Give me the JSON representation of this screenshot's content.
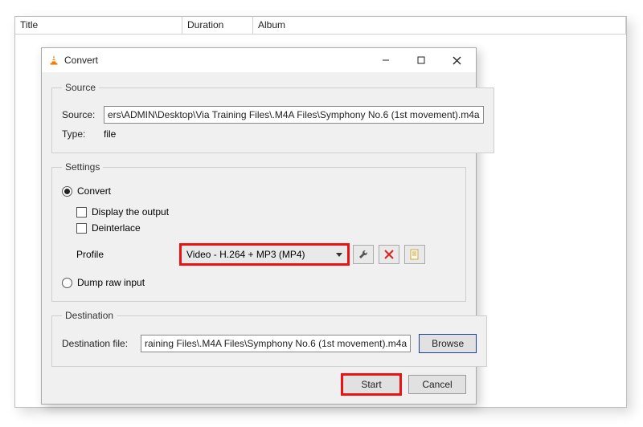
{
  "header": {
    "title": "Title",
    "duration": "Duration",
    "album": "Album"
  },
  "dialog": {
    "title": "Convert",
    "source": {
      "legend": "Source",
      "source_label": "Source:",
      "source_value": "ers\\ADMIN\\Desktop\\Via Training Files\\.M4A Files\\Symphony No.6 (1st movement).m4a",
      "type_label": "Type:",
      "type_value": "file"
    },
    "settings": {
      "legend": "Settings",
      "convert_label": "Convert",
      "display_output_label": "Display the output",
      "deinterlace_label": "Deinterlace",
      "profile_label": "Profile",
      "profile_value": "Video - H.264 + MP3 (MP4)",
      "dump_label": "Dump raw input"
    },
    "destination": {
      "legend": "Destination",
      "label": "Destination file:",
      "value": "raining Files\\.M4A Files\\Symphony No.6 (1st movement).m4a",
      "browse": "Browse"
    },
    "buttons": {
      "start": "Start",
      "cancel": "Cancel"
    }
  }
}
